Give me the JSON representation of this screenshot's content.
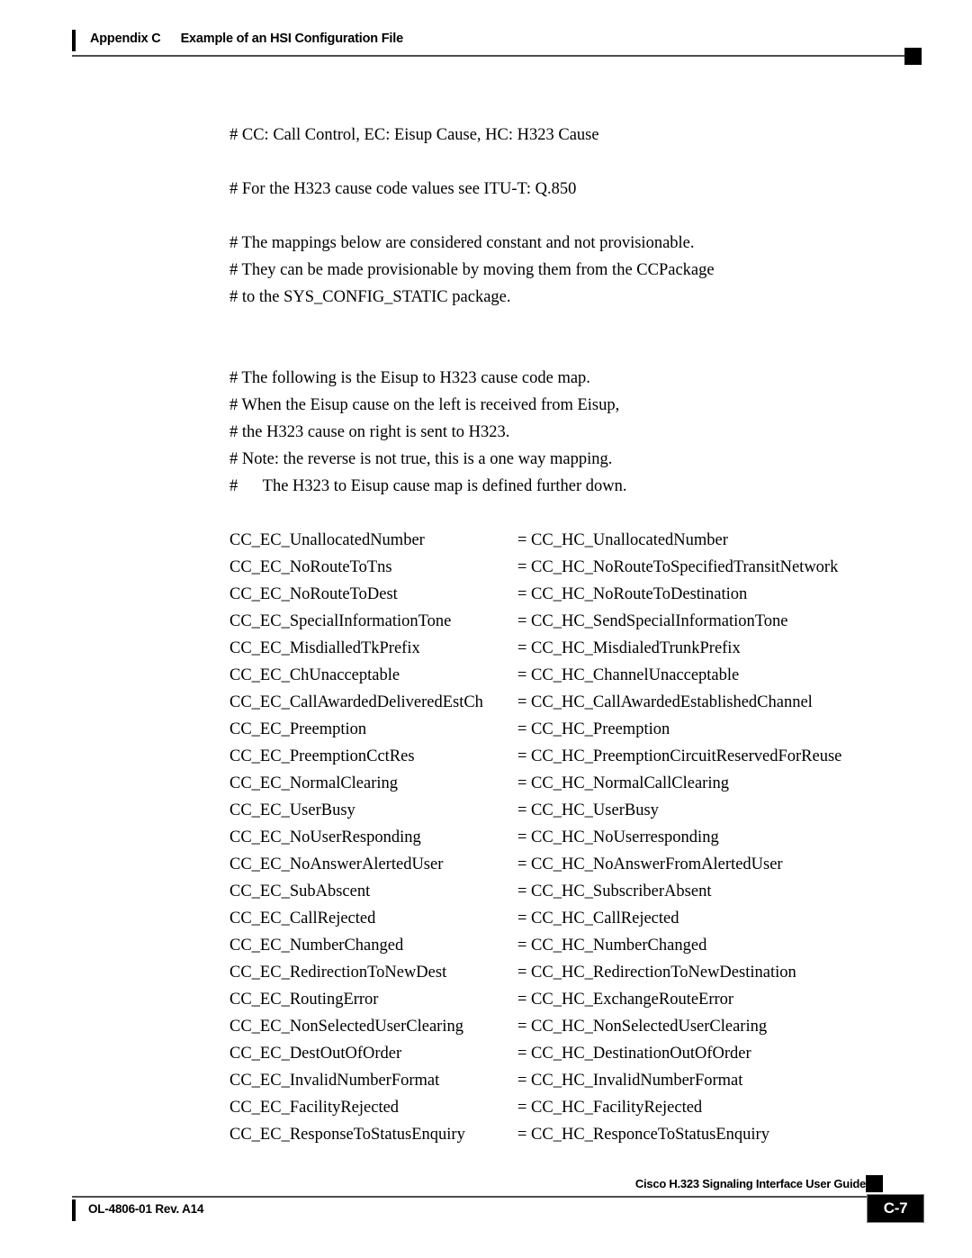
{
  "header": {
    "appendix_label": "Appendix C",
    "title": "Example of an HSI Configuration File"
  },
  "footer": {
    "doc_id": "OL-4806-01 Rev. A14",
    "guide_title": "Cisco H.323 Signaling Interface User Guide",
    "page_number": "C-7"
  },
  "body": {
    "block1": [
      "# CC: Call Control, EC: Eisup Cause, HC: H323 Cause"
    ],
    "block2": [
      "# For the H323 cause code values see ITU-T: Q.850"
    ],
    "block3": [
      "# The mappings below are considered constant and not provisionable.",
      "# They can be made provisionable by moving them from the CCPackage",
      "# to the SYS_CONFIG_STATIC package."
    ],
    "block4": [
      "# The following is the Eisup to H323 cause code map.",
      "# When the Eisup cause on the left is received from Eisup,",
      "# the H323 cause on right is sent to H323.",
      "# Note: the reverse is not true, this is a one way mapping.",
      "#      The H323 to Eisup cause map is defined further down."
    ]
  },
  "mappings": [
    {
      "left": "CC_EC_UnallocatedNumber",
      "right": "= CC_HC_UnallocatedNumber"
    },
    {
      "left": "CC_EC_NoRouteToTns",
      "right": "= CC_HC_NoRouteToSpecifiedTransitNetwork"
    },
    {
      "left": "CC_EC_NoRouteToDest",
      "right": "= CC_HC_NoRouteToDestination"
    },
    {
      "left": "CC_EC_SpecialInformationTone",
      "right": "= CC_HC_SendSpecialInformationTone"
    },
    {
      "left": "CC_EC_MisdialledTkPrefix",
      "right": "= CC_HC_MisdialedTrunkPrefix"
    },
    {
      "left": "CC_EC_ChUnacceptable",
      "right": "= CC_HC_ChannelUnacceptable"
    },
    {
      "left": "CC_EC_CallAwardedDeliveredEstCh",
      "right": "= CC_HC_CallAwardedEstablishedChannel"
    },
    {
      "left": "CC_EC_Preemption",
      "right": "= CC_HC_Preemption"
    },
    {
      "left": "CC_EC_PreemptionCctRes",
      "right": "= CC_HC_PreemptionCircuitReservedForReuse"
    },
    {
      "left": "CC_EC_NormalClearing",
      "right": "= CC_HC_NormalCallClearing"
    },
    {
      "left": "CC_EC_UserBusy",
      "right": "= CC_HC_UserBusy"
    },
    {
      "left": "CC_EC_NoUserResponding",
      "right": "= CC_HC_NoUserresponding"
    },
    {
      "left": "CC_EC_NoAnswerAlertedUser",
      "right": "= CC_HC_NoAnswerFromAlertedUser"
    },
    {
      "left": "CC_EC_SubAbscent",
      "right": "= CC_HC_SubscriberAbsent"
    },
    {
      "left": "CC_EC_CallRejected",
      "right": "= CC_HC_CallRejected"
    },
    {
      "left": "CC_EC_NumberChanged",
      "right": "= CC_HC_NumberChanged"
    },
    {
      "left": "CC_EC_RedirectionToNewDest",
      "right": "= CC_HC_RedirectionToNewDestination"
    },
    {
      "left": "CC_EC_RoutingError",
      "right": "= CC_HC_ExchangeRouteError"
    },
    {
      "left": "CC_EC_NonSelectedUserClearing",
      "right": "= CC_HC_NonSelectedUserClearing"
    },
    {
      "left": "CC_EC_DestOutOfOrder",
      "right": "= CC_HC_DestinationOutOfOrder"
    },
    {
      "left": "CC_EC_InvalidNumberFormat",
      "right": "= CC_HC_InvalidNumberFormat"
    },
    {
      "left": "CC_EC_FacilityRejected",
      "right": "= CC_HC_FacilityRejected"
    },
    {
      "left": "CC_EC_ResponseToStatusEnquiry",
      "right": "= CC_HC_ResponceToStatusEnquiry"
    }
  ]
}
